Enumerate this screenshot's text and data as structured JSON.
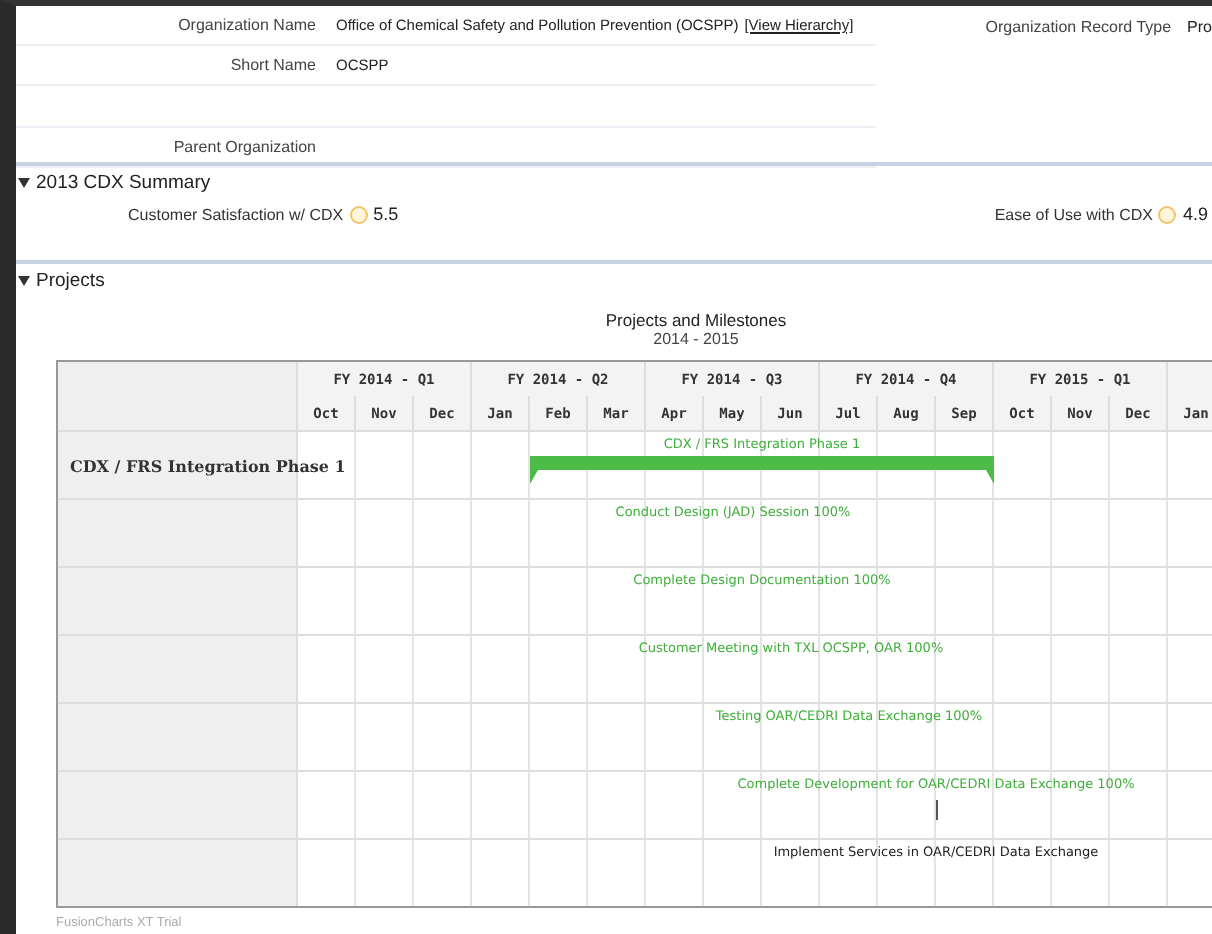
{
  "organization": {
    "left": [
      {
        "label": "Organization Name",
        "value": "Office of Chemical Safety and Pollution Prevention (OCSPP)",
        "link": "[View Hierarchy]"
      },
      {
        "label": "Short Name",
        "value": "OCSPP"
      },
      {
        "label": "Parent Organization"
      }
    ],
    "right": {
      "label": "Organization Record Type",
      "value": "Pro"
    }
  },
  "summary": {
    "title": "2013 CDX Summary",
    "expanded": true,
    "metrics": [
      {
        "label": "Customer Satisfaction w/ CDX",
        "value": "5.5"
      },
      {
        "label": "Ease of Use with CDX",
        "value": "4.9"
      }
    ]
  },
  "projects": {
    "title": "Projects",
    "expanded": true,
    "gantt": {
      "title": "Projects and Milestones",
      "subtitle": "2014 - 2015",
      "quarters": [
        {
          "label": "FY 2014 - Q1",
          "months": [
            "Oct",
            "Nov",
            "Dec"
          ]
        },
        {
          "label": "FY 2014 - Q2",
          "months": [
            "Jan",
            "Feb",
            "Mar"
          ]
        },
        {
          "label": "FY 2014 - Q3",
          "months": [
            "Apr",
            "May",
            "Jun"
          ]
        },
        {
          "label": "FY 2014 - Q4",
          "months": [
            "Jul",
            "Aug",
            "Sep"
          ]
        },
        {
          "label": "FY 2015 - Q1",
          "months": [
            "Oct",
            "Nov",
            "Dec"
          ]
        },
        {
          "months": [
            "Jan"
          ]
        }
      ],
      "rows": [
        {
          "label": "CDX / FRS Integration Phase 1",
          "task": {
            "kind": "bar",
            "name": "CDX / FRS Integration Phase 1"
          }
        },
        {
          "task": {
            "kind": "done",
            "name": "Conduct Design (JAD) Session 100%"
          }
        },
        {
          "task": {
            "kind": "done",
            "name": "Complete Design Documentation 100%"
          }
        },
        {
          "task": {
            "kind": "done",
            "name": "Customer Meeting with TXL OCSPP, OAR 100%"
          }
        },
        {
          "task": {
            "kind": "done",
            "name": "Testing OAR/CEDRI Data Exchange 100%"
          }
        },
        {
          "task": {
            "kind": "milestone",
            "name": "Complete Development for OAR/CEDRI Data Exchange 100%"
          }
        },
        {
          "task": {
            "kind": "pending",
            "name": "Implement Services in OAR/CEDRI Data Exchange"
          }
        }
      ],
      "footer": "FusionCharts XT Trial"
    }
  }
}
